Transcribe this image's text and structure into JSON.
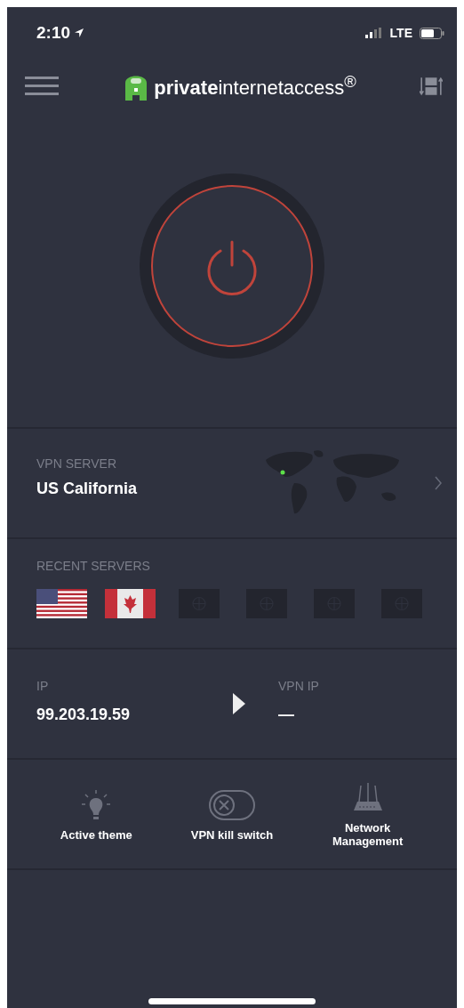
{
  "status_bar": {
    "time": "2:10",
    "network": "LTE"
  },
  "header": {
    "logo": "**private**internetaccess$^{®}$"
  },
  "power": {
    "connected": false
  },
  "vpn_server": {
    "label": "VPN SERVER",
    "value": "US California"
  },
  "recent_servers": {
    "label": "RECENT SERVERS",
    "items": [
      {
        "kind": "us"
      },
      {
        "kind": "ca"
      },
      {
        "kind": "empty"
      },
      {
        "kind": "empty"
      },
      {
        "kind": "empty"
      },
      {
        "kind": "empty"
      }
    ]
  },
  "ip": {
    "label": "IP",
    "value": "99.203.19.59"
  },
  "vpn_ip": {
    "label": "VPN IP",
    "value": "—"
  },
  "quick_actions": [
    {
      "kind": "bulb",
      "label": "Active theme"
    },
    {
      "kind": "toggle",
      "label": "VPN kill switch",
      "on": false
    },
    {
      "kind": "router",
      "label": "Network Management"
    }
  ]
}
